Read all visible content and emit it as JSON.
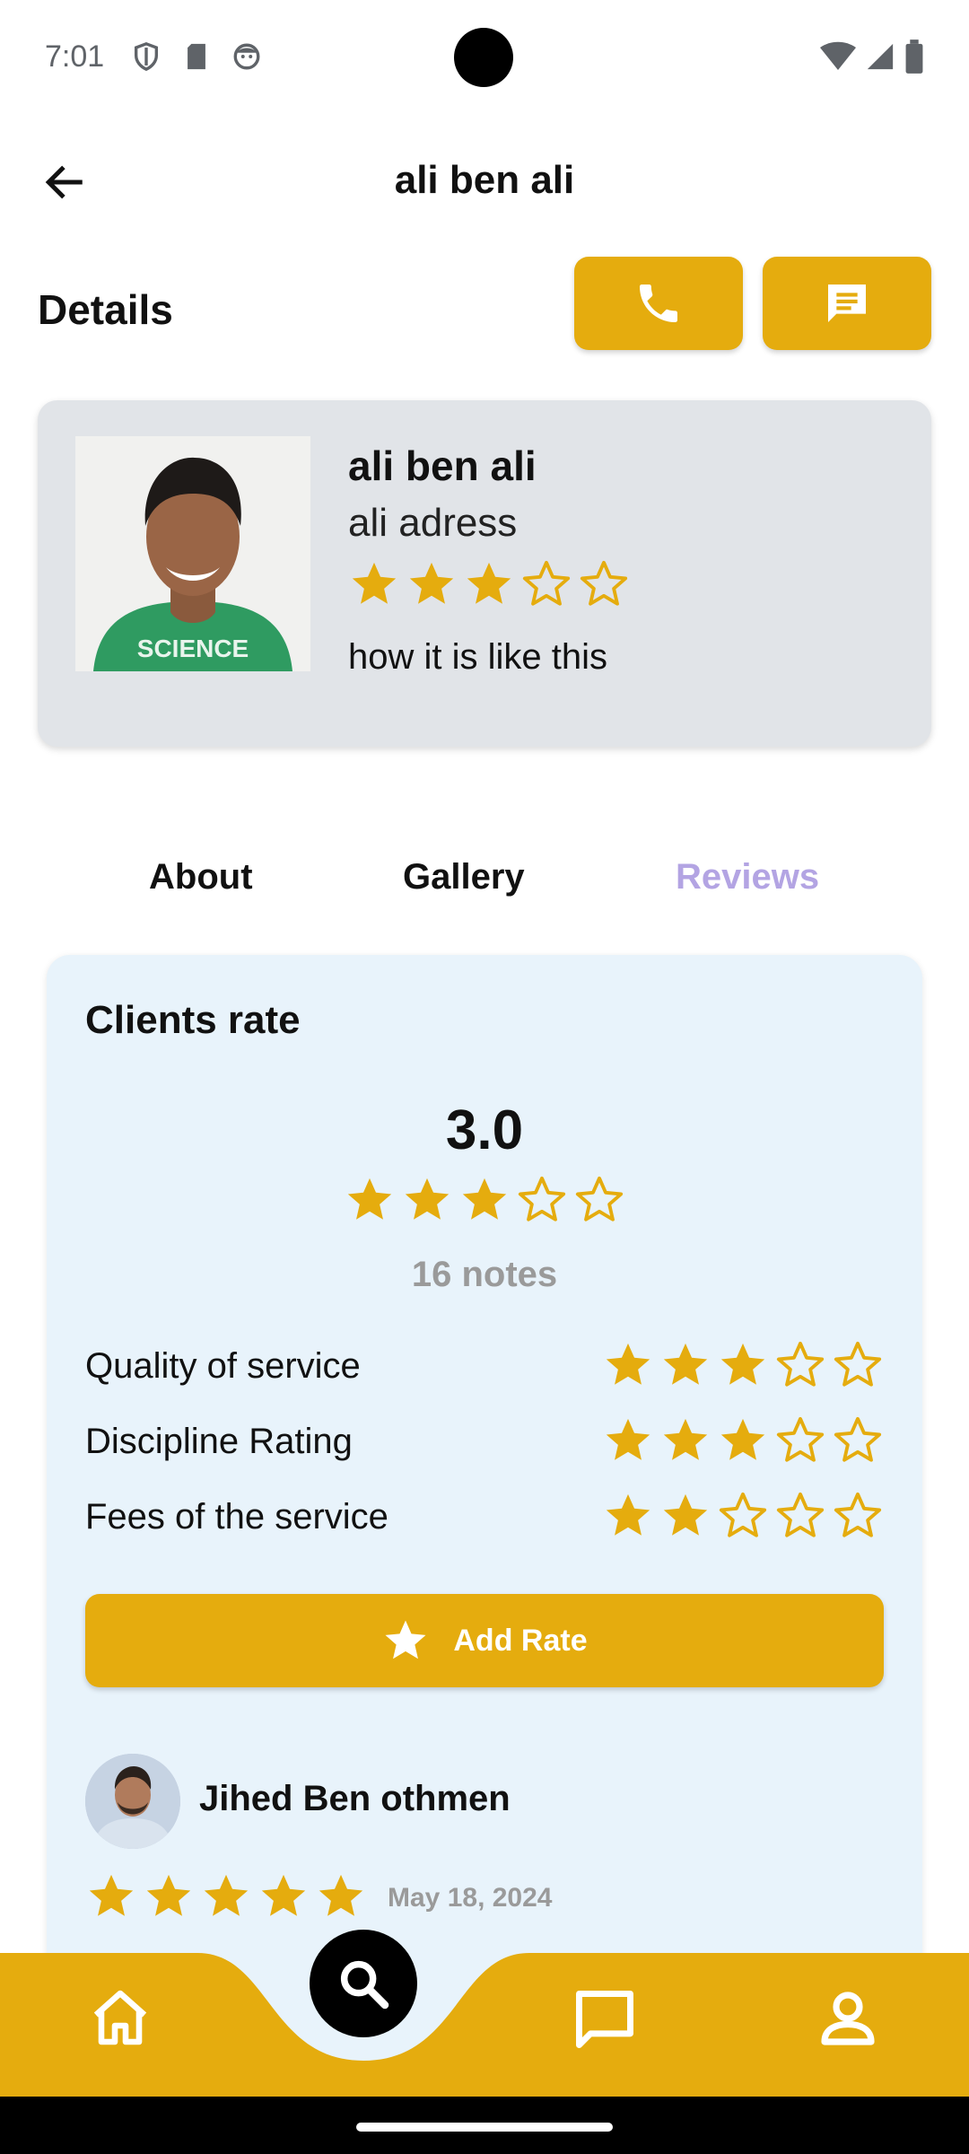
{
  "status_bar": {
    "time": "7:01"
  },
  "app_bar": {
    "title": "ali ben ali"
  },
  "details": {
    "heading": "Details"
  },
  "profile": {
    "name": "ali ben ali",
    "address": "ali adress",
    "rating": 3,
    "description": "how it is like this"
  },
  "tabs": [
    {
      "label": "About"
    },
    {
      "label": "Gallery"
    },
    {
      "label": "Reviews",
      "active": true
    }
  ],
  "reviews": {
    "title": "Clients rate",
    "average": "3.0",
    "average_stars": 3,
    "count_text": "16 notes",
    "criteria": [
      {
        "label": "Quality of service",
        "stars": 3
      },
      {
        "label": "Discipline Rating",
        "stars": 3
      },
      {
        "label": "Fees of the service",
        "stars": 2
      }
    ],
    "add_rate_label": "Add Rate",
    "review": {
      "author": "Jihed Ben othmen",
      "stars": 5,
      "date": "May 18, 2024"
    }
  },
  "colors": {
    "accent": "#E5AC0E",
    "card_bg": "#E1E4E8",
    "reviews_bg": "#E8F3FB",
    "active_tab": "#B3A4E3"
  },
  "icons": {
    "back": "arrow-left-icon",
    "call": "phone-icon",
    "message": "message-icon",
    "home": "home-icon",
    "search": "search-icon",
    "chat": "chat-icon",
    "profile": "person-icon"
  }
}
